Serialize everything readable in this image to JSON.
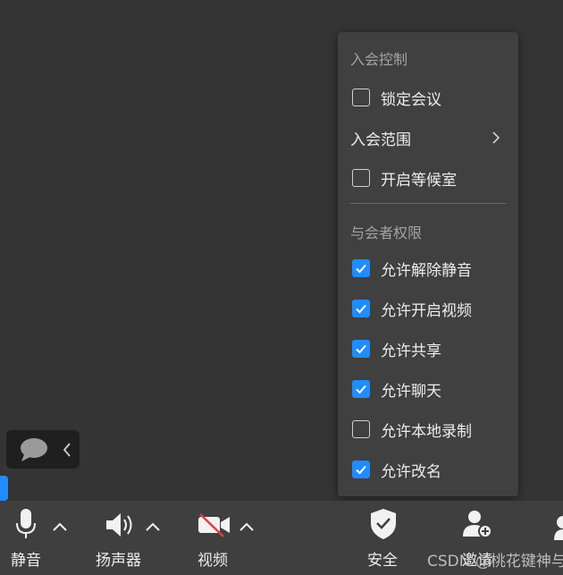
{
  "menu": {
    "section1_title": "入会控制",
    "lock_meeting": {
      "label": "锁定会议",
      "checked": false
    },
    "join_scope": {
      "label": "入会范围"
    },
    "waiting_room": {
      "label": "开启等候室",
      "checked": false
    },
    "section2_title": "与会者权限",
    "permissions": [
      {
        "label": "允许解除静音",
        "checked": true
      },
      {
        "label": "允许开启视频",
        "checked": true
      },
      {
        "label": "允许共享",
        "checked": true
      },
      {
        "label": "允许聊天",
        "checked": true
      },
      {
        "label": "允许本地录制",
        "checked": false
      },
      {
        "label": "允许改名",
        "checked": true
      }
    ]
  },
  "toolbar": {
    "mute_label": "静音",
    "speaker_label": "扬声器",
    "video_label": "视频",
    "security_label": "安全",
    "invite_label": "邀请"
  },
  "watermark": "CSDN @桃花键神与",
  "colors": {
    "accent": "#1f8cff",
    "menu_bg": "#404040",
    "toolbar_bg": "#3f3f3f"
  }
}
